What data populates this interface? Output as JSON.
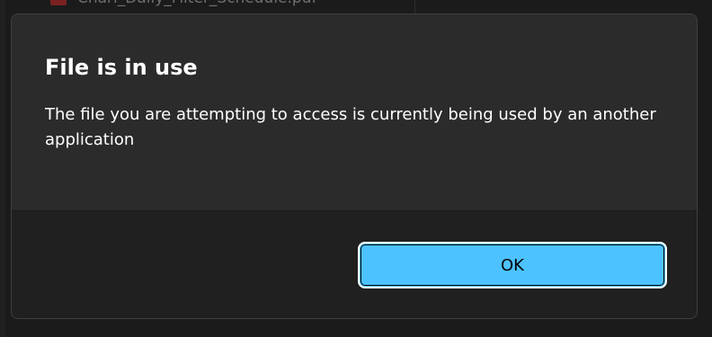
{
  "background": {
    "file_name": "Charl_Daily_Filter_Schedule.pdf"
  },
  "dialog": {
    "title": "File is in use",
    "message": "The file you are attempting to access is currently being used by an another application",
    "ok_label": "OK"
  },
  "colors": {
    "accent": "#4cc2ff",
    "dialog_bg": "#2b2b2b",
    "footer_bg": "#202020"
  }
}
